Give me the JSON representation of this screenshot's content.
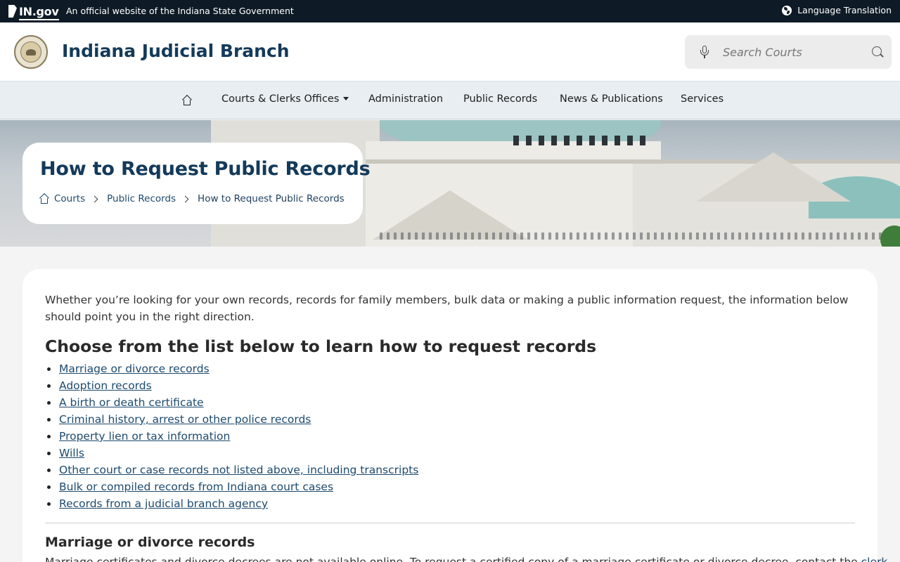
{
  "topbar": {
    "logo_text": "IN.gov",
    "official_text": "An official website of the Indiana State Government",
    "language_label": "Language Translation"
  },
  "header": {
    "site_title": "Indiana Judicial Branch",
    "search_placeholder": "Search Courts"
  },
  "nav": {
    "items": [
      {
        "label": "Courts & Clerks Offices",
        "has_dropdown": true
      },
      {
        "label": "Administration"
      },
      {
        "label": "Public Records"
      },
      {
        "label": "News & Publications"
      },
      {
        "label": "Services"
      }
    ]
  },
  "hero": {
    "title": "How to Request Public Records",
    "breadcrumbs": [
      "Courts",
      "Public Records",
      "How to Request Public Records"
    ]
  },
  "content": {
    "intro": "Whether you’re looking for your own records, records for family members, bulk data or making a public information request, the information below should point you in the right direction.",
    "list_heading": "Choose from the list below to learn how to request records",
    "links": [
      "Marriage or divorce records",
      "Adoption records",
      "A birth or death certificate",
      "Criminal history, arrest or other police records",
      "Property lien or tax information",
      "Wills",
      "Other court or case records not listed above, including transcripts",
      "Bulk or compiled records from Indiana court cases",
      "Records from a judicial branch agency"
    ],
    "section_heading": "Marriage or divorce records",
    "section_text_start": "Marriage certificates and divorce decrees are not available online. To request a certified copy of a marriage certificate or divorce decree, contact the",
    "section_link": "clerk"
  },
  "colors": {
    "topbar_bg": "#0e1b26",
    "title_blue": "#143a5a",
    "link_blue": "#1d4a6e",
    "nav_bg": "#e8eef2"
  }
}
